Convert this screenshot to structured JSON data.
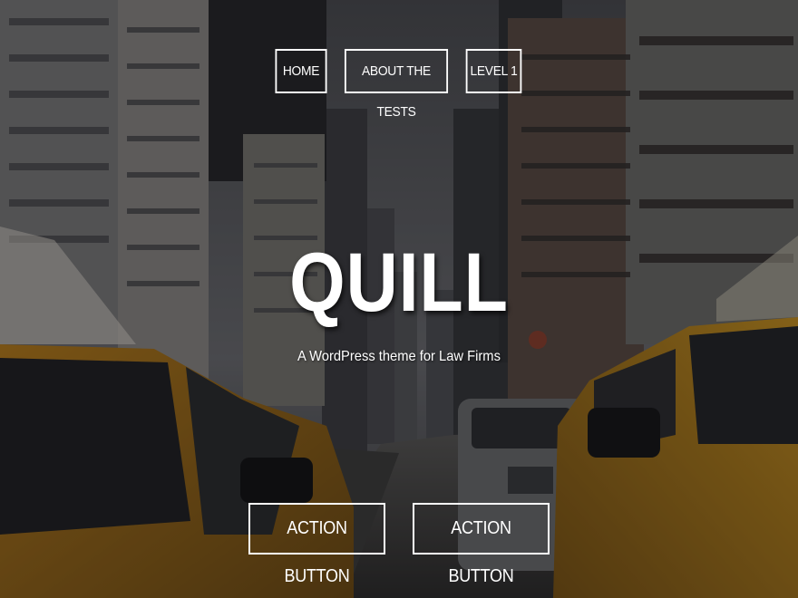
{
  "nav": {
    "items": [
      {
        "label": "HOME"
      },
      {
        "label": "ABOUT THE TESTS"
      },
      {
        "label": "LEVEL 1"
      }
    ]
  },
  "hero": {
    "title": "QUILL",
    "tagline": "A WordPress theme for Law Firms",
    "background_image": "city-street-with-yellow-taxis"
  },
  "actions": [
    {
      "label": "ACTION BUTTON"
    },
    {
      "label": "ACTION BUTTON"
    }
  ],
  "colors": {
    "text": "#ffffff",
    "button_border": "#ffffff",
    "overlay": "#0a0a0c",
    "taxi_yellow": "#c98d1c"
  }
}
